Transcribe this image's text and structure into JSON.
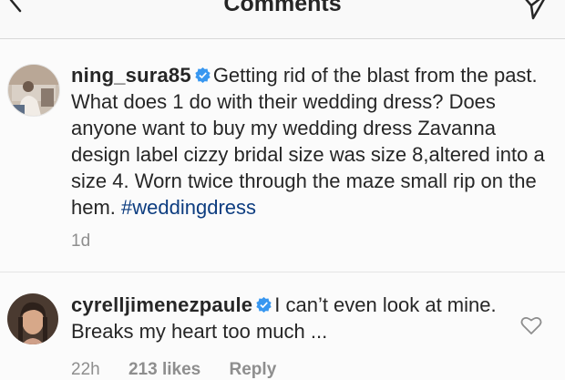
{
  "header": {
    "title": "Comments"
  },
  "caption": {
    "username": "ning_sura85",
    "text": "Getting rid of the blast from the past. What does 1 do with their wedding dress? Does anyone want to buy my wedding dress Zavanna design label cizzy bridal size was size 8,altered into a size 4. Worn twice through the maze small rip on the hem.",
    "hashtag": "#weddingdress",
    "time": "1d"
  },
  "comment": {
    "username": "cyrelljimenezpaule",
    "text": "I can’t even look at mine. Breaks my heart too much ...",
    "time": "22h",
    "likes": "213 likes",
    "reply_label": "Reply"
  },
  "colors": {
    "verified": "#3897f0",
    "hashtag": "#0d3d80",
    "meta": "#8e8e8e"
  }
}
